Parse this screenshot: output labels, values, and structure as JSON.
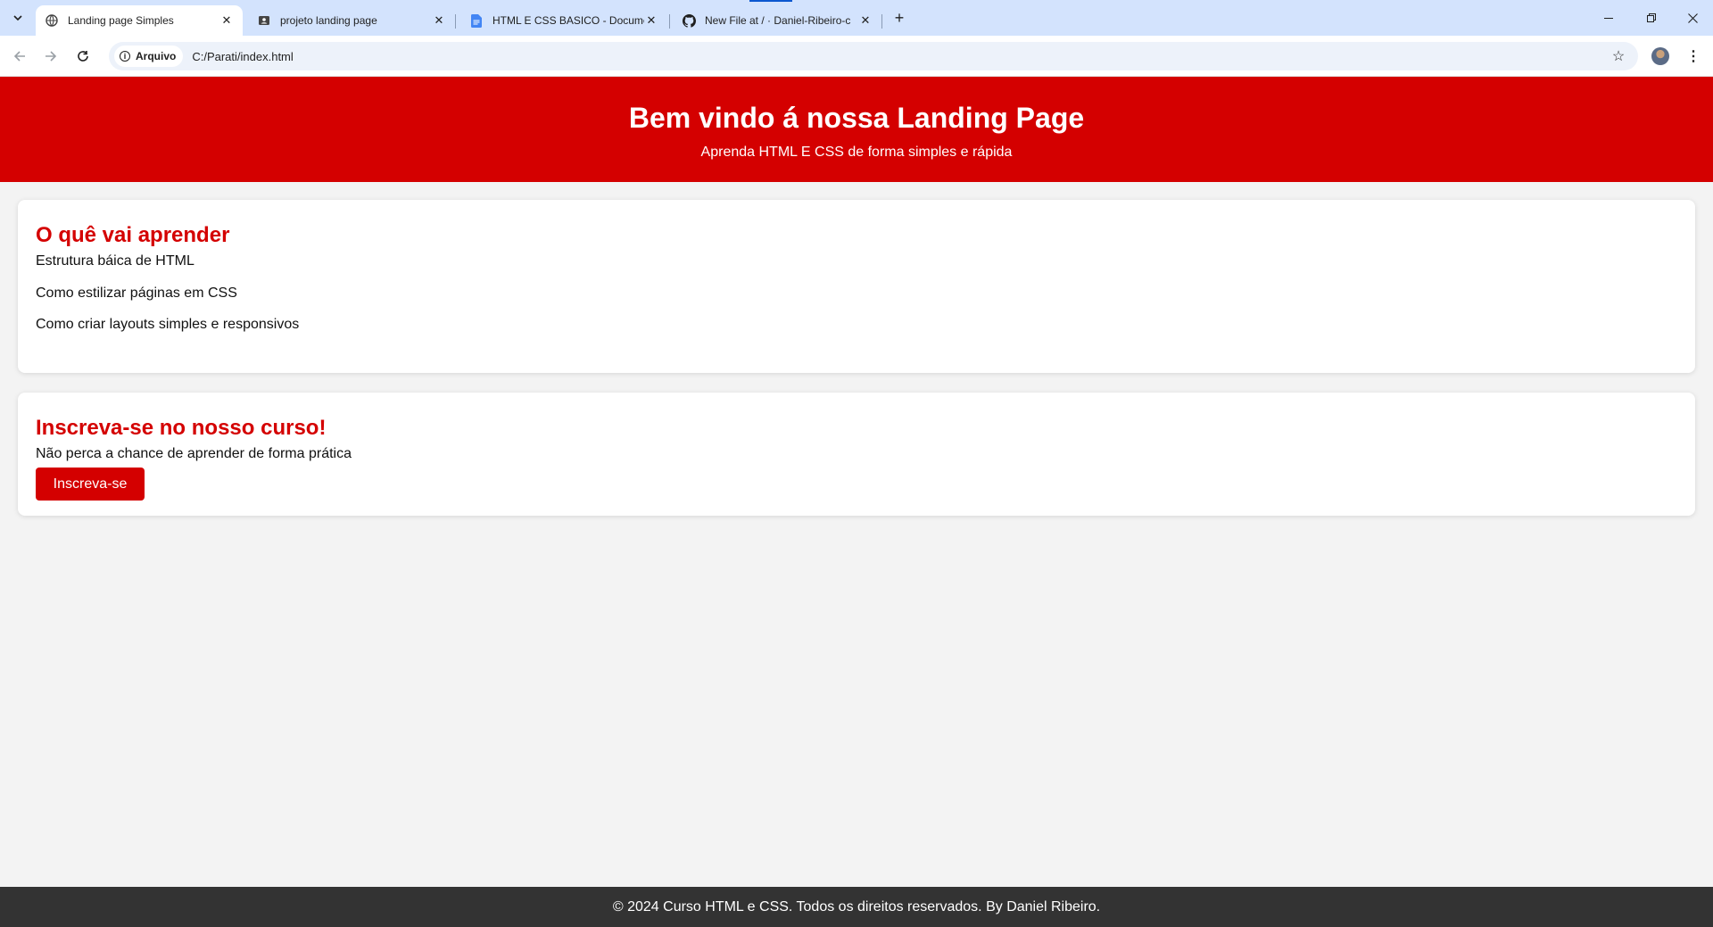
{
  "browser": {
    "tabs": [
      {
        "title": "Landing page Simples",
        "favicon": "globe-icon",
        "active": true
      },
      {
        "title": "projeto landing page",
        "favicon": "slides-icon",
        "active": false
      },
      {
        "title": "HTML E CSS BASICO - Documen",
        "favicon": "docs-icon",
        "active": false
      },
      {
        "title": "New File at / · Daniel-Ribeiro-c",
        "favicon": "github-icon",
        "active": false
      }
    ],
    "site_chip": "Arquivo",
    "url": "C:/Parati/index.html"
  },
  "hero": {
    "title": "Bem vindo á nossa Landing Page",
    "subtitle": "Aprenda HTML E CSS de forma simples e rápida"
  },
  "learn": {
    "heading": "O quê vai aprender",
    "items": [
      "Estrutura báica de HTML",
      "Como estilizar páginas em CSS",
      "Como criar layouts simples e responsivos"
    ]
  },
  "signup": {
    "heading": "Inscreva-se no nosso curso!",
    "description": "Não perca a chance de aprender de forma prática",
    "button_label": "Inscreva-se"
  },
  "footer": {
    "text": "© 2024 Curso HTML e CSS. Todos os direitos reservados. By Daniel Ribeiro."
  },
  "colors": {
    "brand_red": "#d40000",
    "footer_bg": "#333333",
    "page_bg": "#f3f3f3"
  }
}
